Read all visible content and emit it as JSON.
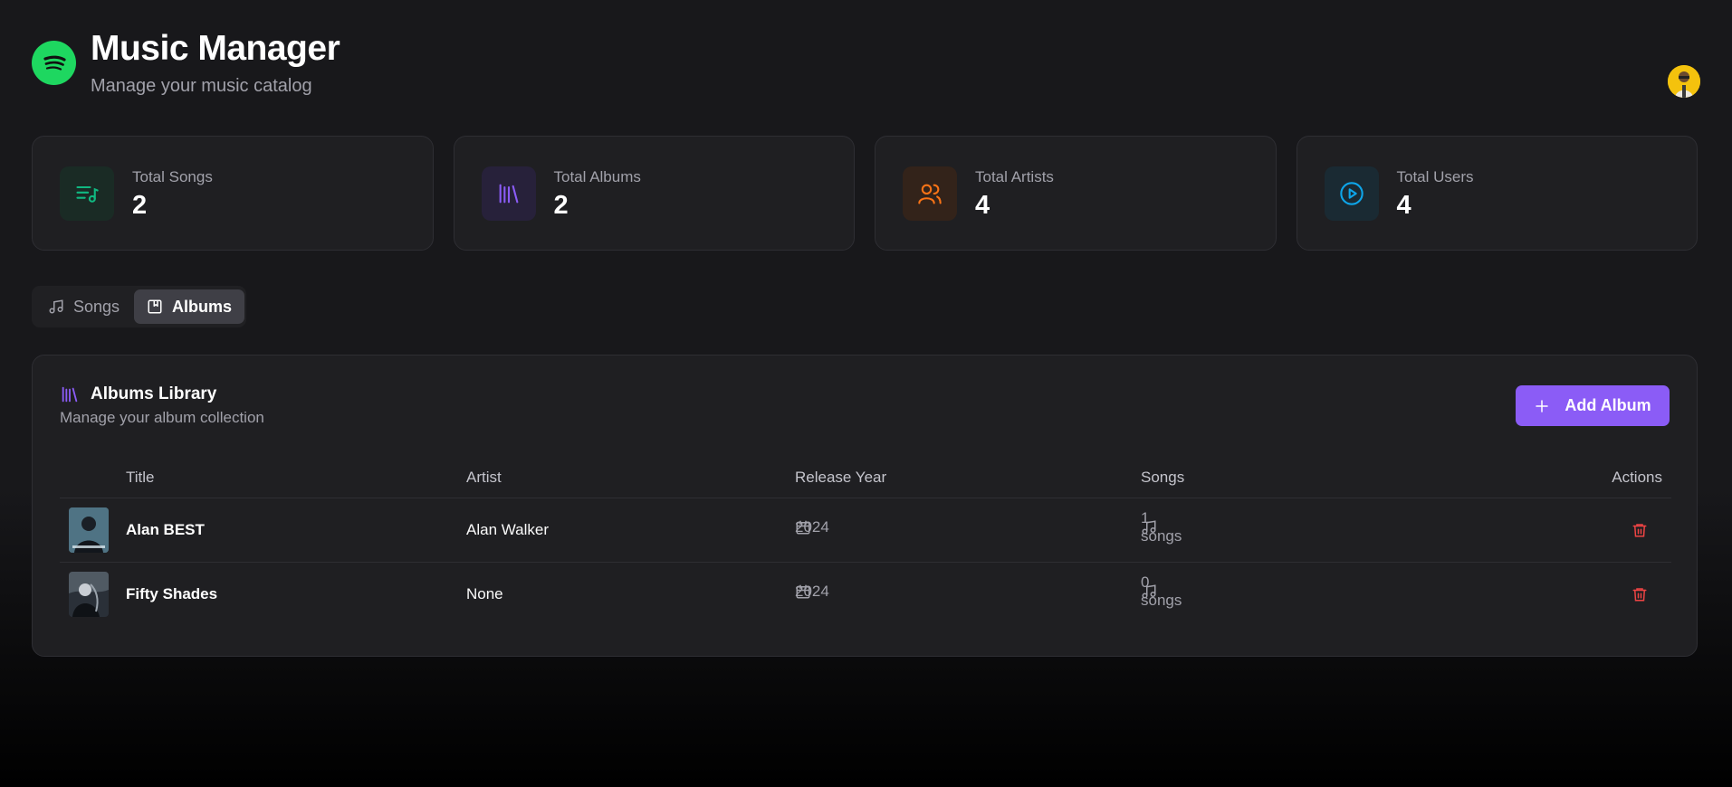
{
  "header": {
    "title": "Music Manager",
    "subtitle": "Manage your music catalog",
    "logo_icon": "spotify-logo",
    "avatar_icon": "user-avatar"
  },
  "stats": [
    {
      "label": "Total Songs",
      "value": "2",
      "icon": "list-music-icon",
      "color": "#10b981"
    },
    {
      "label": "Total Albums",
      "value": "2",
      "icon": "library-icon",
      "color": "#8b5cf6"
    },
    {
      "label": "Total Artists",
      "value": "4",
      "icon": "users-icon",
      "color": "#f97316"
    },
    {
      "label": "Total Users",
      "value": "4",
      "icon": "play-circle-icon",
      "color": "#0ea5e9"
    }
  ],
  "tabs": [
    {
      "label": "Songs",
      "icon": "music-note-icon",
      "active": false
    },
    {
      "label": "Albums",
      "icon": "album-icon",
      "active": true
    }
  ],
  "albums_panel": {
    "title": "Albums Library",
    "subtitle": "Manage your album collection",
    "add_label": "Add Album",
    "columns": [
      "Title",
      "Artist",
      "Release Year",
      "Songs",
      "Actions"
    ],
    "rows": [
      {
        "title": "Alan BEST",
        "artist": "Alan Walker",
        "year": "2024",
        "songs": "1 songs"
      },
      {
        "title": "Fifty Shades",
        "artist": "None",
        "year": "2024",
        "songs": "0 songs"
      }
    ]
  },
  "colors": {
    "accent": "#8b5cf6",
    "brand": "#1ed760",
    "danger": "#ef4444",
    "background": "#18181b",
    "card": "#1f1f22"
  }
}
